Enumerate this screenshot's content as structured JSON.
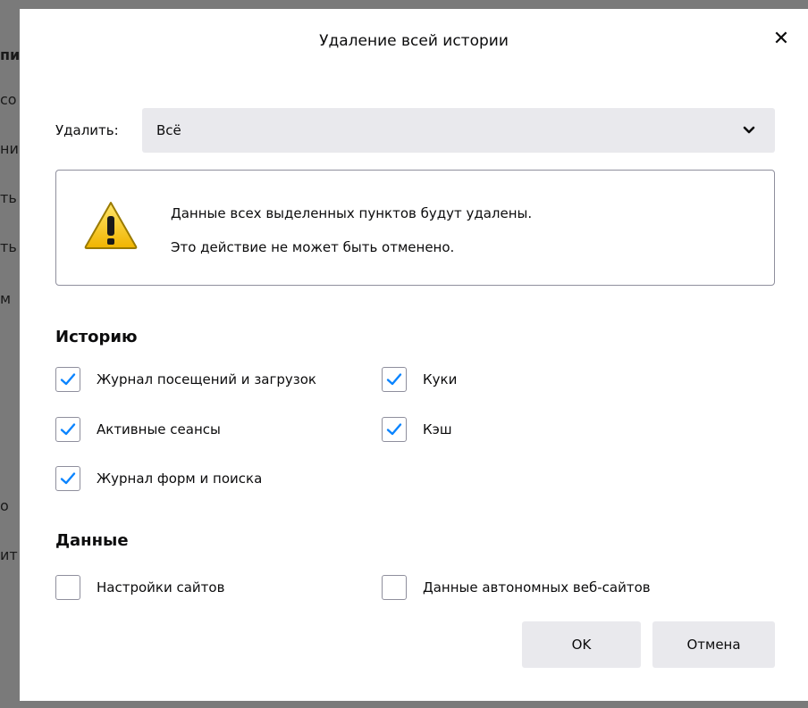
{
  "background_fragments": [
    "пи",
    "со",
    "ни",
    "ть",
    "ть",
    "м",
    "о",
    "ит"
  ],
  "dialog": {
    "title": "Удаление всей истории",
    "close_glyph": "✕"
  },
  "timerange": {
    "label": "Удалить:",
    "selected": "Всё"
  },
  "warning": {
    "line1": "Данные всех выделенных пунктов будут удалены.",
    "line2": "Это действие не может быть отменено."
  },
  "history_section": {
    "heading": "Историю",
    "items": [
      {
        "label": "Журнал посещений и загрузок",
        "checked": true
      },
      {
        "label": "Куки",
        "checked": true
      },
      {
        "label": "Активные сеансы",
        "checked": true
      },
      {
        "label": "Кэш",
        "checked": true
      },
      {
        "label": "Журнал форм и поиска",
        "checked": true
      }
    ]
  },
  "data_section": {
    "heading": "Данные",
    "items": [
      {
        "label": "Настройки сайтов",
        "checked": false
      },
      {
        "label": "Данные автономных веб-сайтов",
        "checked": false
      }
    ]
  },
  "buttons": {
    "ok": "OK",
    "cancel": "Отмена"
  },
  "colors": {
    "accent": "#0a84ff",
    "button_bg": "#e9e9ed",
    "warning_yellow": "#f5c518"
  },
  "icons": {
    "close": "close-icon",
    "dropdown": "chevron-down-icon",
    "warning": "warning-icon",
    "checkmark": "checkmark-icon"
  }
}
